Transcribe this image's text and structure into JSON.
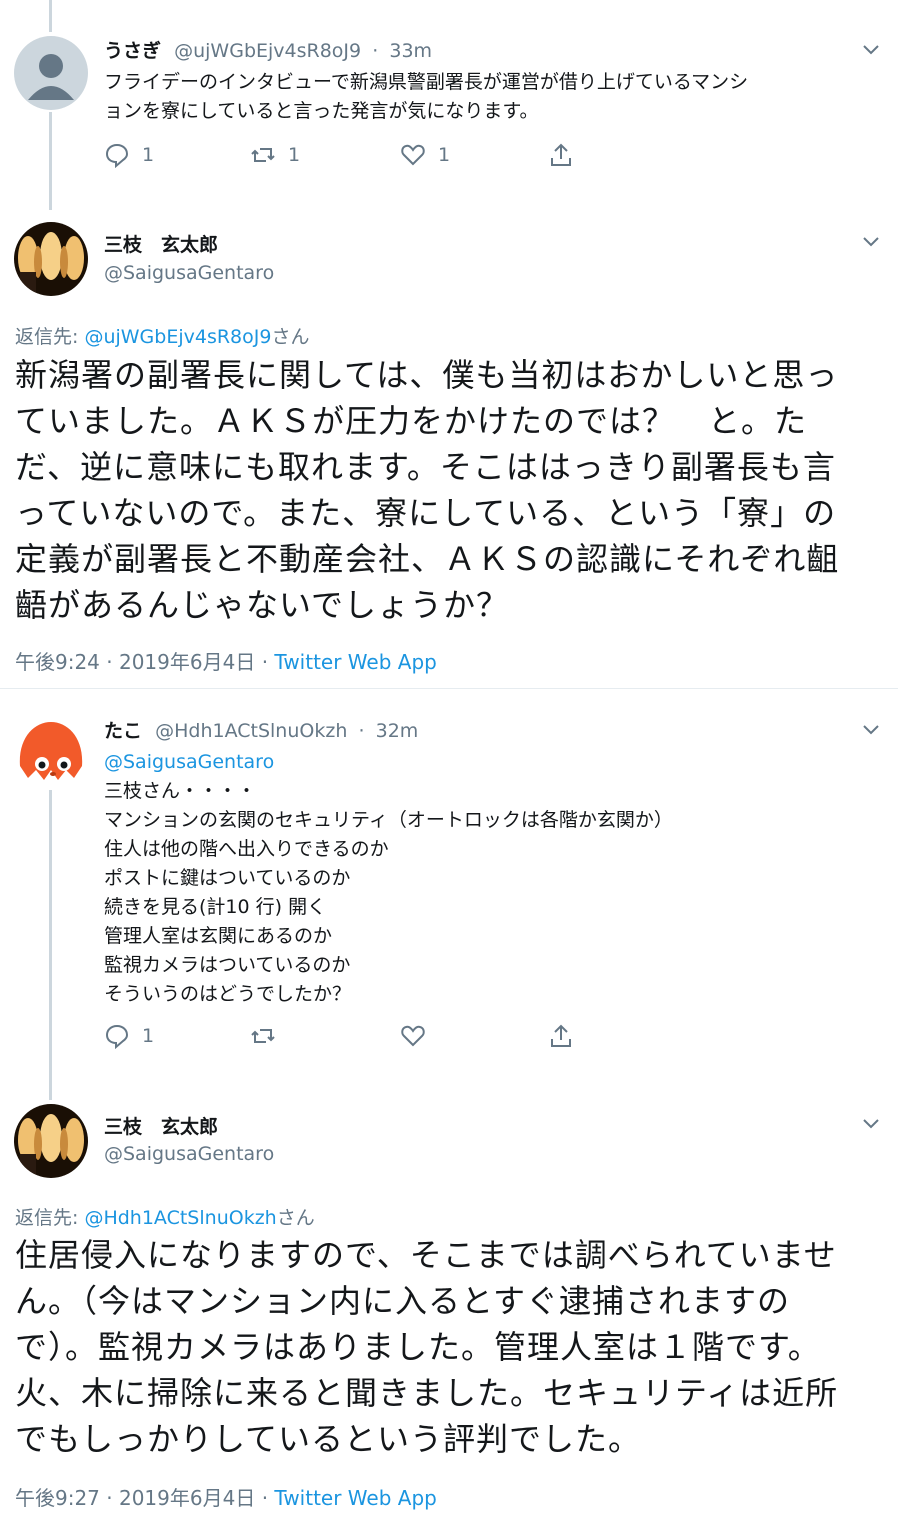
{
  "tweet1": {
    "name": "うさぎ",
    "handle": "@ujWGbEjv4sR8oJ9",
    "time": "33m",
    "lines": [
      "フライデーのインタビューで新潟県警副署長が運営が借り上げているマンシ",
      "ョンを寮にしていると言った発言が気になります。"
    ],
    "reply_count": "1",
    "retweet_count": "1",
    "like_count": "1"
  },
  "tweet2": {
    "name": "三枝　玄太郎",
    "handle": "@SaigusaGentaro",
    "replying_label": "返信先: ",
    "replying_handle": "@ujWGbEjv4sR8oJ9",
    "replying_suffix": "さん",
    "lines": [
      "新潟署の副署長に関しては、僕も当初はおかしいと思っ",
      "ていました。ＡＫＳが圧力をかけたのでは？　と。た",
      "だ、逆に意味にも取れます。そこははっきり副署長も言",
      "っていないので。また、寮にしている、という「寮」の",
      "定義が副署長と不動産会社、ＡＫＳの認識にそれぞれ齟",
      "齬があるんじゃないでしょうか？"
    ],
    "timestamp": "午後9:24 · 2019年6月4日 · ",
    "source": "Twitter Web App"
  },
  "tweet3": {
    "name": "たこ",
    "handle": "@Hdh1ACtSlnuOkzh",
    "time": "32m",
    "mention": "@SaigusaGentaro",
    "lines": [
      "三枝さん・・・・",
      "マンションの玄関のセキュリティ（オートロックは各階か玄関か）",
      "住人は他の階へ出入りできるのか",
      "ポストに鍵はついているのか",
      "続きを見る(計10 行) 開く",
      "管理人室は玄関にあるのか",
      "監視カメラはついているのか",
      "そういうのはどうでしたか？"
    ],
    "reply_count": "1"
  },
  "tweet4": {
    "name": "三枝　玄太郎",
    "handle": "@SaigusaGentaro",
    "replying_label": "返信先: ",
    "replying_handle": "@Hdh1ACtSlnuOkzh",
    "replying_suffix": "さん",
    "lines": [
      "住居侵入になりますので、そこまでは調べられていませ",
      "ん。（今はマンション内に入るとすぐ逮捕されますの",
      "で）。監視カメラはありました。管理人室は１階です。",
      "火、木に掃除に来ると聞きました。セキュリティは近所",
      "でもしっかりしているという評判でした。"
    ],
    "timestamp": "午後9:27 · 2019年6月4日 · ",
    "source": "Twitter Web App"
  },
  "colors": {
    "accent": "#1b95e0",
    "secondary_text": "#657786",
    "thread_line": "#ccd6dd"
  },
  "icons": [
    "reply-icon",
    "retweet-icon",
    "like-icon",
    "share-icon",
    "chevron-down-icon"
  ]
}
